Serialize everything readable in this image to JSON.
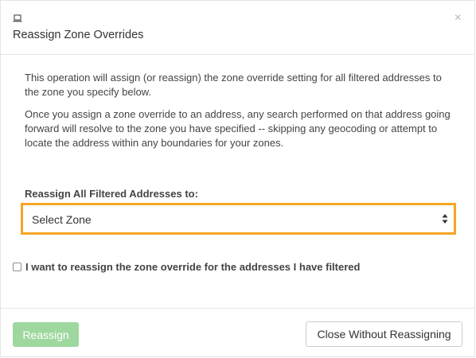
{
  "modal": {
    "title": "Reassign Zone Overrides",
    "close_glyph": "×",
    "header_icon": "laptop-icon",
    "description_1": "This operation will assign (or reassign) the zone override setting for all filtered addresses to the zone you specify below.",
    "description_2": "Once you assign a zone override to an address, any search performed on that address going forward will resolve to the zone you have specified -- skipping any geocoding or attempt to locate the address within any boundaries for your zones.",
    "field_label": "Reassign All Filtered Addresses to:",
    "zone_select": {
      "selected": "Select Zone"
    },
    "checkbox": {
      "checked": false,
      "label": "I want to reassign the zone override for the addresses I have filtered"
    },
    "buttons": {
      "reassign": "Reassign",
      "close": "Close Without Reassigning"
    }
  },
  "colors": {
    "focus_border": "#f5a623",
    "primary_disabled": "#9fd89f"
  }
}
